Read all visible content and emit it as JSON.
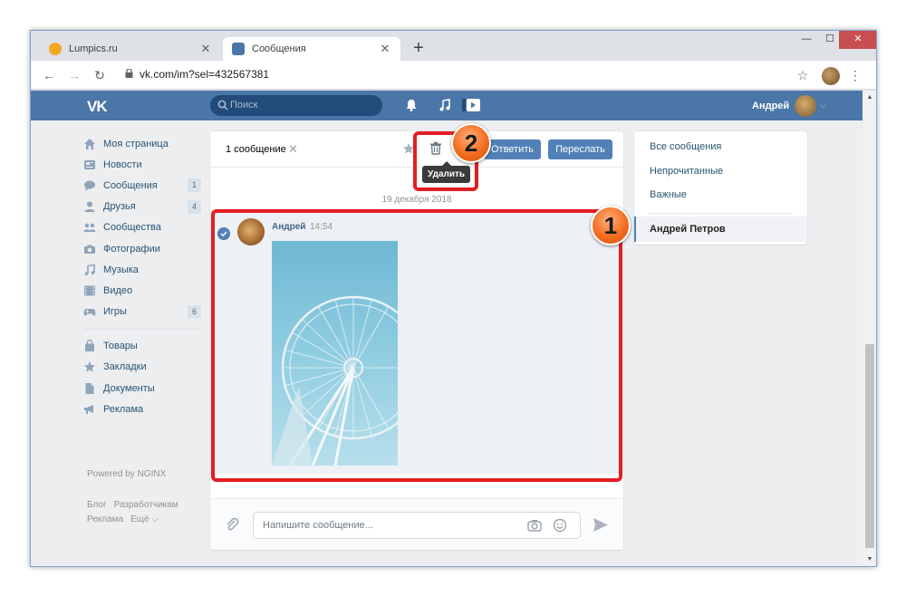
{
  "browser": {
    "tabs": [
      {
        "title": "Lumpics.ru",
        "active": false
      },
      {
        "title": "Сообщения",
        "active": true
      }
    ],
    "new_tab": "+",
    "window_controls": {
      "minimize": "—",
      "maximize": "☐",
      "close": "✕"
    },
    "url": "vk.com/im?sel=432567381",
    "nav": {
      "back": "←",
      "forward": "→",
      "reload": "↻"
    },
    "menu_dots": "⋮",
    "bookmark_star": "☆"
  },
  "vk": {
    "logo": "VK",
    "search_placeholder": "Поиск",
    "user_name": "Андрей",
    "brand_color": "#4a76a8",
    "left_menu": [
      {
        "label": "Моя страница",
        "icon": "home-icon",
        "badge": ""
      },
      {
        "label": "Новости",
        "icon": "news-icon",
        "badge": ""
      },
      {
        "label": "Сообщения",
        "icon": "messages-icon",
        "badge": "1"
      },
      {
        "label": "Друзья",
        "icon": "friends-icon",
        "badge": "4"
      },
      {
        "label": "Сообщества",
        "icon": "communities-icon",
        "badge": ""
      },
      {
        "label": "Фотографии",
        "icon": "camera-icon",
        "badge": ""
      },
      {
        "label": "Музыка",
        "icon": "music-icon",
        "badge": ""
      },
      {
        "label": "Видео",
        "icon": "video-icon",
        "badge": ""
      },
      {
        "label": "Игры",
        "icon": "gamepad-icon",
        "badge": "6"
      }
    ],
    "left_menu_2": [
      {
        "label": "Товары",
        "icon": "bag-icon"
      },
      {
        "label": "Закладки",
        "icon": "star-icon"
      },
      {
        "label": "Документы",
        "icon": "document-icon"
      },
      {
        "label": "Реклама",
        "icon": "megaphone-icon"
      }
    ],
    "powered_by": "Powered by NGINX",
    "footer": {
      "blog": "Блог",
      "developers": "Разработчикам",
      "ads": "Реклама",
      "more": "Ещё ⌵"
    }
  },
  "messages": {
    "selected_count": "1 сообщение",
    "clear_selection": "✕",
    "reply_label": "Ответить",
    "forward_label": "Переслать",
    "delete_tooltip": "Удалить",
    "date_divider": "19 декабря 2018",
    "message": {
      "author": "Андрей",
      "time": "14:54"
    },
    "compose_placeholder": "Напишите сообщение..."
  },
  "right_menu": {
    "all": "Все сообщения",
    "unread": "Непрочитанные",
    "important": "Важные",
    "active_chat": "Андрей Петров"
  },
  "annotations": {
    "step_1": "1",
    "step_2": "2",
    "highlight_color": "#e31e24",
    "badge_color": "#f36c21"
  }
}
